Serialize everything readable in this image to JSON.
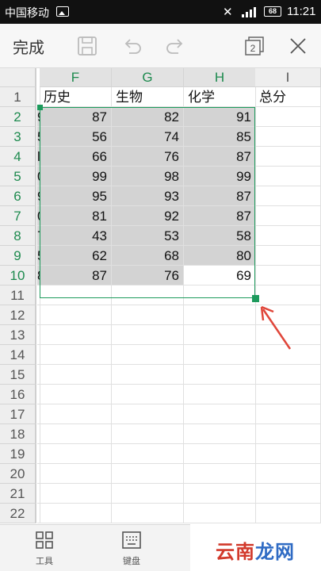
{
  "status_bar": {
    "carrier": "中国移动",
    "mute_icon": "mute-icon",
    "battery": "68",
    "time": "11:21"
  },
  "toolbar": {
    "done_label": "完成",
    "icons": [
      "save-icon",
      "undo-icon",
      "redo-icon",
      "window-count-icon",
      "close-icon"
    ],
    "window_count": "2"
  },
  "sheet": {
    "columns": [
      "F",
      "G",
      "H",
      "I"
    ],
    "rows": [
      "1",
      "2",
      "3",
      "4",
      "5",
      "6",
      "7",
      "8",
      "9",
      "10",
      "11",
      "12",
      "13",
      "14",
      "15",
      "16",
      "17",
      "18",
      "19",
      "20",
      "21",
      "22"
    ],
    "partial_left_digits": [
      "9",
      "5",
      "l",
      "0",
      "9",
      "0",
      "7",
      "5",
      "8"
    ],
    "header_row": [
      "历史",
      "生物",
      "化学",
      "总分"
    ],
    "data": [
      [
        87,
        82,
        91
      ],
      [
        56,
        74,
        85
      ],
      [
        66,
        76,
        87
      ],
      [
        99,
        98,
        99
      ],
      [
        95,
        93,
        87
      ],
      [
        81,
        92,
        87
      ],
      [
        43,
        53,
        58
      ],
      [
        62,
        68,
        80
      ],
      [
        87,
        76,
        69
      ]
    ],
    "selection_color": "#1d9a5c",
    "highlight_color": "#d3d3d3"
  },
  "bottom_bar": {
    "tools_label": "工具",
    "keyboard_label": "键盘",
    "tools_icon": "grid-icon",
    "keyboard_icon": "keyboard-icon"
  },
  "annotation": {
    "arrow_color": "#e0463a"
  },
  "watermark": {
    "part1": "云南",
    "part2": "龙网"
  }
}
